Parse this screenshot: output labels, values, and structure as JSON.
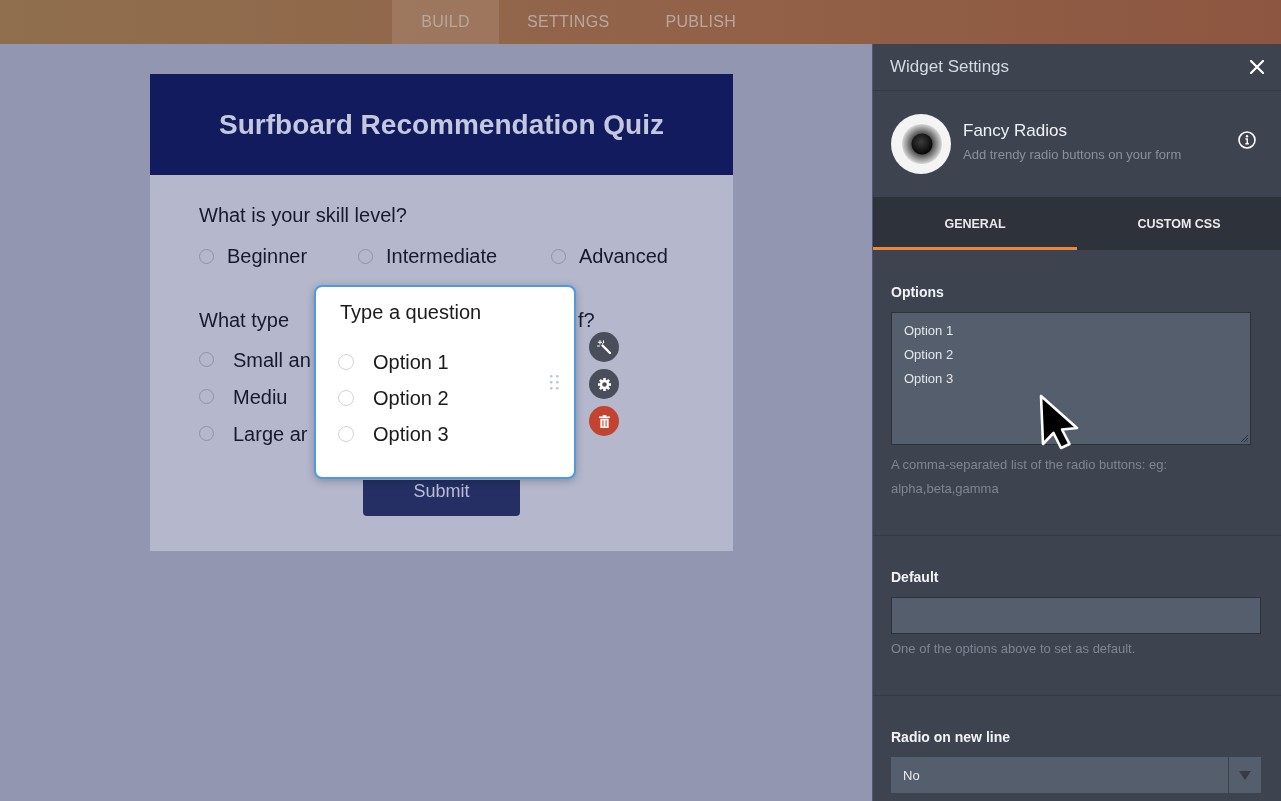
{
  "top_bar": {
    "tabs": [
      {
        "label": "BUILD",
        "selected": true
      },
      {
        "label": "SETTINGS",
        "selected": false
      },
      {
        "label": "PUBLISH",
        "selected": false
      }
    ]
  },
  "form": {
    "title": "Surfboard Recommendation Quiz",
    "questions": [
      {
        "kind": "inline",
        "label": "What is your skill level?",
        "options": [
          {
            "label": "Beginner",
            "selected": false
          },
          {
            "label": "Intermediate",
            "selected": false
          },
          {
            "label": "Advanced",
            "selected": false
          }
        ]
      },
      {
        "kind": "stacked",
        "label": "What type",
        "label_end": "f?",
        "options": [
          {
            "label": "Small an",
            "selected": false
          },
          {
            "label": "Mediu",
            "selected": false
          },
          {
            "label": "Large ar",
            "selected": false
          }
        ]
      }
    ],
    "submit": "Submit"
  },
  "widget_popup": {
    "question": "Type a question",
    "options": [
      {
        "label": "Option 1",
        "selected": false
      },
      {
        "label": "Option 2",
        "selected": false
      },
      {
        "label": "Option 3",
        "selected": false
      }
    ]
  },
  "settings_panel": {
    "title": "Widget Settings",
    "widget": {
      "name": "Fancy Radios",
      "description": "Add trendy radio buttons on your form"
    },
    "tabs": [
      {
        "label": "GENERAL",
        "selected": true
      },
      {
        "label": "CUSTOM CSS",
        "selected": false
      }
    ],
    "fields": [
      {
        "kind": "textarea",
        "label": "Options",
        "value": "Option 1\nOption 2\nOption 3",
        "help": "A comma-separated list of the radio buttons: eg: alpha,beta,gamma"
      },
      {
        "kind": "text",
        "label": "Default",
        "help": "One of the options above to set as default."
      },
      {
        "kind": "select",
        "label": "Radio on new line",
        "value": "No"
      }
    ]
  }
}
